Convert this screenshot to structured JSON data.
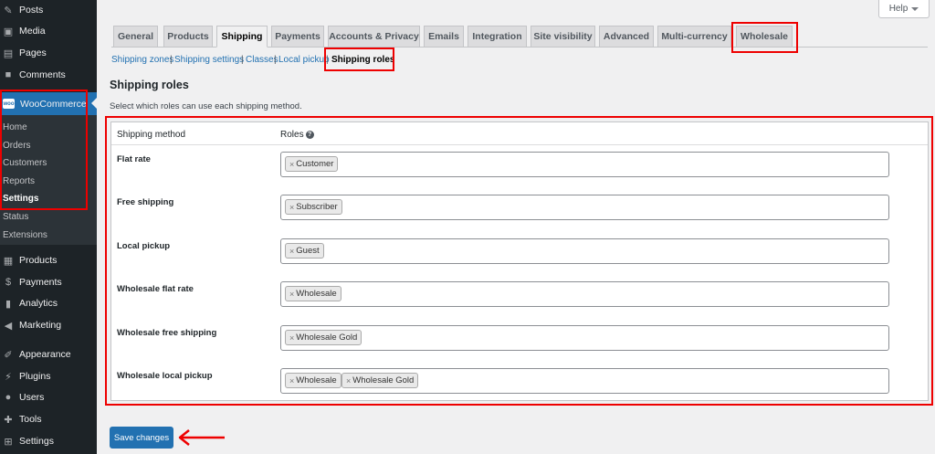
{
  "sidebar": {
    "items": [
      {
        "label": "Posts",
        "icon": "pin-icon"
      },
      {
        "label": "Media",
        "icon": "media-icon"
      },
      {
        "label": "Pages",
        "icon": "pages-icon"
      },
      {
        "label": "Comments",
        "icon": "comments-icon"
      },
      {
        "label": "WooCommerce",
        "icon": "woocommerce-icon",
        "icon_text": "woo"
      },
      {
        "label": "Products",
        "icon": "archive-icon"
      },
      {
        "label": "Payments",
        "icon": "dollar-icon"
      },
      {
        "label": "Analytics",
        "icon": "bar-chart-icon"
      },
      {
        "label": "Marketing",
        "icon": "megaphone-icon"
      },
      {
        "label": "Appearance",
        "icon": "brush-icon"
      },
      {
        "label": "Plugins",
        "icon": "plug-icon"
      },
      {
        "label": "Users",
        "icon": "users-icon"
      },
      {
        "label": "Tools",
        "icon": "wrench-icon"
      },
      {
        "label": "Settings",
        "icon": "settings-icon"
      }
    ],
    "woo_submenu": [
      "Home",
      "Orders",
      "Customers",
      "Reports",
      "Settings",
      "Status",
      "Extensions"
    ]
  },
  "help": {
    "label": "Help"
  },
  "tabs": [
    "General",
    "Products",
    "Shipping",
    "Payments",
    "Accounts & Privacy",
    "Emails",
    "Integration",
    "Site visibility",
    "Advanced",
    "Multi-currency",
    "Wholesale"
  ],
  "subsections": [
    "Shipping zones",
    "Shipping settings",
    "Classes",
    "Local pickup",
    "Shipping roles"
  ],
  "section": {
    "title": "Shipping roles",
    "description": "Select which roles can use each shipping method."
  },
  "table": {
    "col_method": "Shipping method",
    "col_roles": "Roles",
    "rows": [
      {
        "method": "Flat rate",
        "roles": [
          "Customer"
        ]
      },
      {
        "method": "Free shipping",
        "roles": [
          "Subscriber"
        ]
      },
      {
        "method": "Local pickup",
        "roles": [
          "Guest"
        ]
      },
      {
        "method": "Wholesale flat rate",
        "roles": [
          "Wholesale"
        ]
      },
      {
        "method": "Wholesale free shipping",
        "roles": [
          "Wholesale Gold"
        ]
      },
      {
        "method": "Wholesale local pickup",
        "roles": [
          "Wholesale",
          "Wholesale Gold"
        ]
      }
    ]
  },
  "save_label": "Save changes",
  "colors": {
    "highlight": "#e00000",
    "primary": "#2271b1",
    "sidebar": "#1d2327"
  }
}
